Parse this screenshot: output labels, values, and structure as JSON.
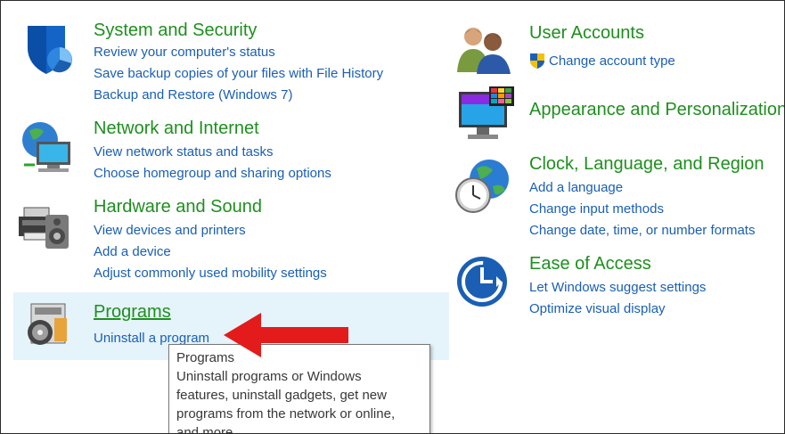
{
  "categories": {
    "system_security": {
      "title": "System and Security",
      "links": [
        "Review your computer's status",
        "Save backup copies of your files with File History",
        "Backup and Restore (Windows 7)"
      ]
    },
    "network_internet": {
      "title": "Network and Internet",
      "links": [
        "View network status and tasks",
        "Choose homegroup and sharing options"
      ]
    },
    "hardware_sound": {
      "title": "Hardware and Sound",
      "links": [
        "View devices and printers",
        "Add a device",
        "Adjust commonly used mobility settings"
      ]
    },
    "programs": {
      "title": "Programs",
      "links": [
        "Uninstall a program"
      ]
    },
    "user_accounts": {
      "title": "User Accounts",
      "links": [
        "Change account type"
      ]
    },
    "appearance": {
      "title": "Appearance and Personalization",
      "links": []
    },
    "clock_region": {
      "title": "Clock, Language, and Region",
      "links": [
        "Add a language",
        "Change input methods",
        "Change date, time, or number formats"
      ]
    },
    "ease_access": {
      "title": "Ease of Access",
      "links": [
        "Let Windows suggest settings",
        "Optimize visual display"
      ]
    }
  },
  "tooltip": {
    "lines": [
      "Programs",
      "Uninstall programs or Windows",
      "features, uninstall gadgets, get new",
      "programs from the network or online,",
      "and more."
    ]
  },
  "icons": {
    "system_security": "shield-icon",
    "network_internet": "network-globe-icon",
    "hardware_sound": "printer-speaker-icon",
    "programs": "programs-disc-icon",
    "user_accounts": "users-icon",
    "appearance": "monitor-palette-icon",
    "clock_region": "globe-clock-icon",
    "ease_access": "ease-of-access-icon",
    "uac": "uac-shield-icon",
    "annotation": "red-arrow-icon"
  },
  "colors": {
    "category_title": "#1e8f1e",
    "link": "#1a5fb4",
    "hover_highlight": "#e5f3fb",
    "arrow": "#e31b1b"
  }
}
